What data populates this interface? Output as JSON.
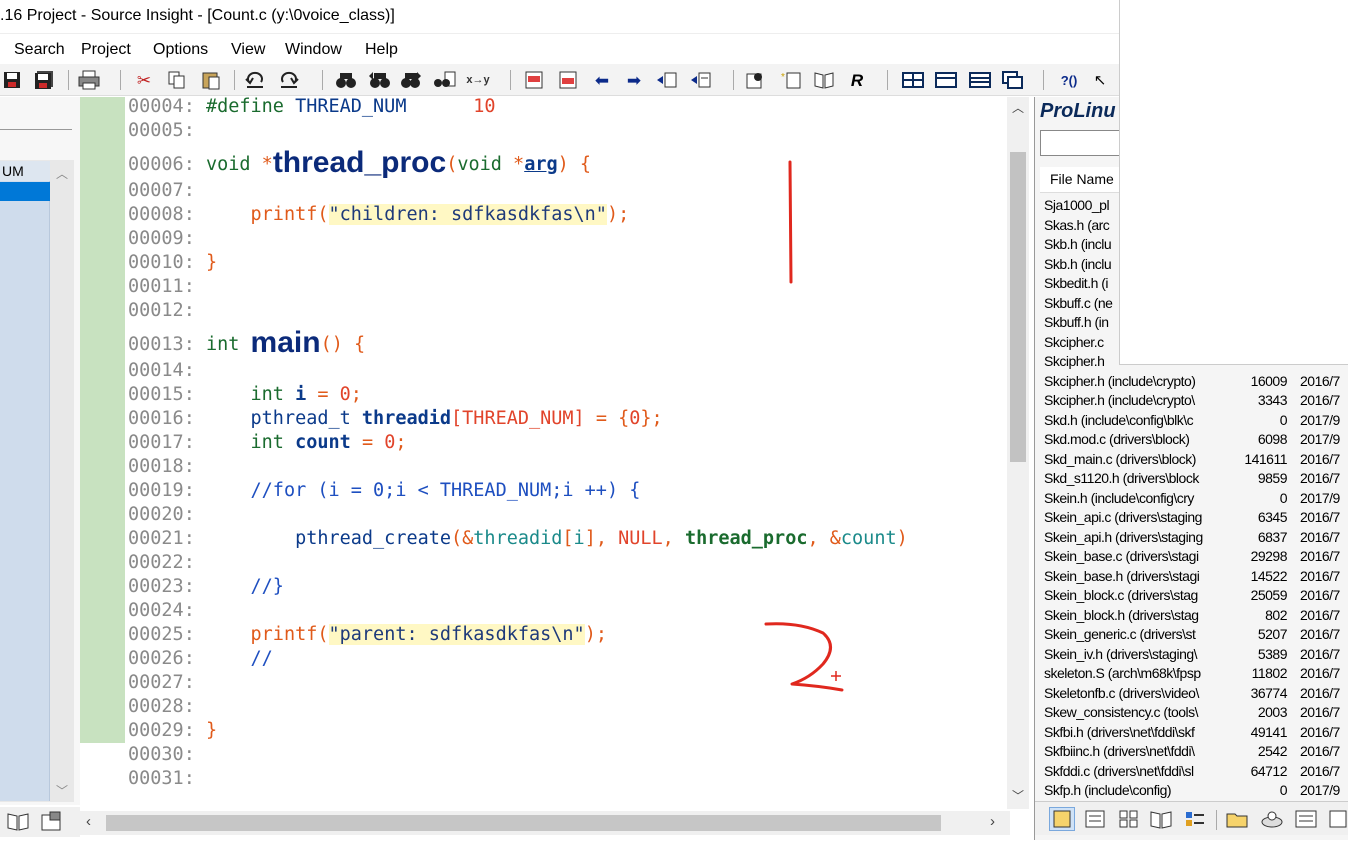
{
  "window": {
    "title": ".16 Project - Source Insight - [Count.c (y:\\0voice_class)]"
  },
  "menu": [
    "Search",
    "Project",
    "Options",
    "View",
    "Window",
    "Help"
  ],
  "toolbar_icons": [
    "save-icon",
    "save-all-icon",
    "print-icon",
    "cut-icon",
    "copy-icon",
    "paste-icon",
    "undo-icon",
    "redo-icon",
    "find-icon",
    "find-prev-icon",
    "find-next-icon",
    "find-in-files-icon",
    "replace-icon",
    "bookmark-prev-icon",
    "bookmark-next-icon",
    "back-icon",
    "forward-icon",
    "jump-prev-icon",
    "jump-next-icon",
    "lookup-icon",
    "new-reference-icon",
    "relation-icon",
    "browse-icon",
    "tile-icon",
    "split-horizontal-icon",
    "split-vertical-icon",
    "cascade-icon",
    "help-icon"
  ],
  "left_panel": {
    "header": "UM"
  },
  "editor": {
    "lines": [
      {
        "n": "00004:",
        "code": "#define THREAD_NUM     10"
      },
      {
        "n": "00005:",
        "code": ""
      },
      {
        "n": "00006:",
        "code": "void *thread_proc(void *arg) {"
      },
      {
        "n": "00007:",
        "code": ""
      },
      {
        "n": "00008:",
        "code": "    printf(\"children: sdfkasdkfas\\n\");"
      },
      {
        "n": "00009:",
        "code": ""
      },
      {
        "n": "00010:",
        "code": "}"
      },
      {
        "n": "00011:",
        "code": ""
      },
      {
        "n": "00012:",
        "code": ""
      },
      {
        "n": "00013:",
        "code": "int main() {"
      },
      {
        "n": "00014:",
        "code": ""
      },
      {
        "n": "00015:",
        "code": "    int i = 0;"
      },
      {
        "n": "00016:",
        "code": "    pthread_t threadid[THREAD_NUM] = {0};"
      },
      {
        "n": "00017:",
        "code": "    int count = 0;"
      },
      {
        "n": "00018:",
        "code": ""
      },
      {
        "n": "00019:",
        "code": "    //for (i = 0;i < THREAD_NUM;i ++) {"
      },
      {
        "n": "00020:",
        "code": ""
      },
      {
        "n": "00021:",
        "code": "        pthread_create(&threadid[i], NULL, thread_proc, &count)"
      },
      {
        "n": "00022:",
        "code": ""
      },
      {
        "n": "00023:",
        "code": "    //}"
      },
      {
        "n": "00024:",
        "code": ""
      },
      {
        "n": "00025:",
        "code": "    printf(\"parent: sdfkasdkfas\\n\");"
      },
      {
        "n": "00026:",
        "code": "    //"
      },
      {
        "n": "00027:",
        "code": ""
      },
      {
        "n": "00028:",
        "code": ""
      },
      {
        "n": "00029:",
        "code": "}"
      },
      {
        "n": "00030:",
        "code": ""
      },
      {
        "n": "00031:",
        "code": ""
      }
    ]
  },
  "project_panel": {
    "title": "ProLinu",
    "search_value": "",
    "column_header": "File Name",
    "files": [
      {
        "name": "Sja1000_pl",
        "size": "",
        "date": ""
      },
      {
        "name": "Skas.h (arc",
        "size": "",
        "date": ""
      },
      {
        "name": "Skb.h (inclu",
        "size": "",
        "date": ""
      },
      {
        "name": "Skb.h (inclu",
        "size": "",
        "date": ""
      },
      {
        "name": "Skbedit.h (i",
        "size": "",
        "date": ""
      },
      {
        "name": "Skbuff.c (ne",
        "size": "",
        "date": ""
      },
      {
        "name": "Skbuff.h (in",
        "size": "",
        "date": ""
      },
      {
        "name": "Skcipher.c",
        "size": "",
        "date": ""
      },
      {
        "name": "Skcipher.h",
        "size": "",
        "date": ""
      },
      {
        "name": "Skcipher.h (include\\crypto)",
        "size": "16009",
        "date": "2016/7"
      },
      {
        "name": "Skcipher.h (include\\crypto\\",
        "size": "3343",
        "date": "2016/7"
      },
      {
        "name": "Skd.h (include\\config\\blk\\c",
        "size": "0",
        "date": "2017/9"
      },
      {
        "name": "Skd.mod.c (drivers\\block)",
        "size": "6098",
        "date": "2017/9"
      },
      {
        "name": "Skd_main.c (drivers\\block)",
        "size": "141611",
        "date": "2016/7"
      },
      {
        "name": "Skd_s1120.h (drivers\\block",
        "size": "9859",
        "date": "2016/7"
      },
      {
        "name": "Skein.h (include\\config\\cry",
        "size": "0",
        "date": "2017/9"
      },
      {
        "name": "Skein_api.c (drivers\\staging",
        "size": "6345",
        "date": "2016/7"
      },
      {
        "name": "Skein_api.h (drivers\\staging",
        "size": "6837",
        "date": "2016/7"
      },
      {
        "name": "Skein_base.c (drivers\\stagi",
        "size": "29298",
        "date": "2016/7"
      },
      {
        "name": "Skein_base.h (drivers\\stagi",
        "size": "14522",
        "date": "2016/7"
      },
      {
        "name": "Skein_block.c (drivers\\stag",
        "size": "25059",
        "date": "2016/7"
      },
      {
        "name": "Skein_block.h (drivers\\stag",
        "size": "802",
        "date": "2016/7"
      },
      {
        "name": "Skein_generic.c (drivers\\st",
        "size": "5207",
        "date": "2016/7"
      },
      {
        "name": "Skein_iv.h (drivers\\staging\\",
        "size": "5389",
        "date": "2016/7"
      },
      {
        "name": "skeleton.S (arch\\m68k\\fpsp",
        "size": "11802",
        "date": "2016/7"
      },
      {
        "name": "Skeletonfb.c (drivers\\video\\",
        "size": "36774",
        "date": "2016/7"
      },
      {
        "name": "Skew_consistency.c (tools\\",
        "size": "2003",
        "date": "2016/7"
      },
      {
        "name": "Skfbi.h (drivers\\net\\fddi\\skf",
        "size": "49141",
        "date": "2016/7"
      },
      {
        "name": "Skfbiinc.h (drivers\\net\\fddi\\",
        "size": "2542",
        "date": "2016/7"
      },
      {
        "name": "Skfddi.c (drivers\\net\\fddi\\sl",
        "size": "64712",
        "date": "2016/7"
      },
      {
        "name": "Skfp.h (include\\config)",
        "size": "0",
        "date": "2017/9"
      }
    ]
  },
  "annotations": {
    "stroke_color": "#e0281e"
  }
}
